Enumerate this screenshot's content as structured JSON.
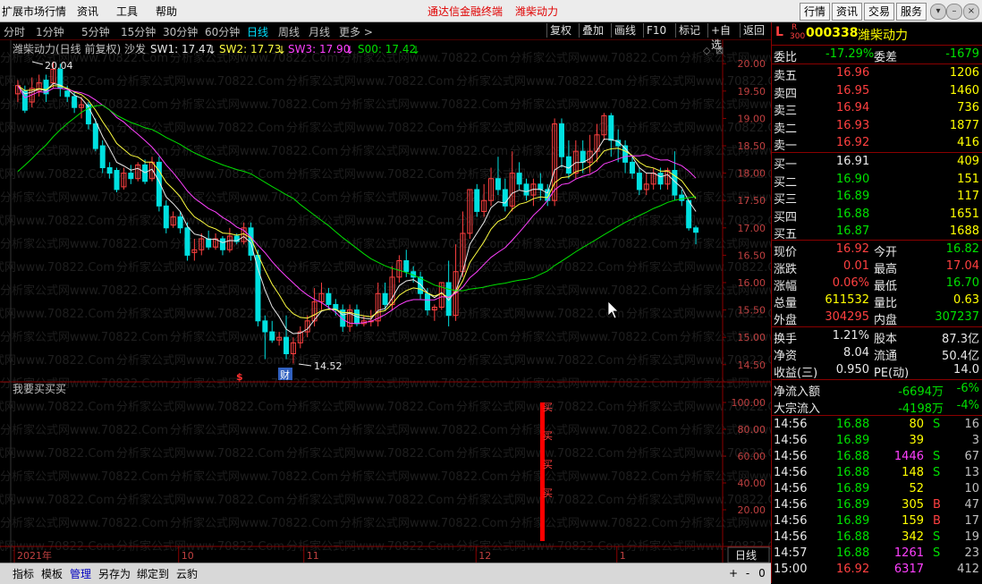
{
  "menubar": {
    "items": [
      "扩展市场行情",
      "资讯",
      "工具",
      "帮助"
    ],
    "center_title": "通达信金融终端",
    "center_stock": "潍柴动力",
    "right_buttons": [
      "行情",
      "资讯",
      "交易",
      "服务"
    ],
    "window_controls": [
      "▾",
      "–",
      "□",
      "×"
    ]
  },
  "periodbar": {
    "periods": [
      "分时",
      "1分钟",
      "5分钟",
      "15分钟",
      "30分钟",
      "60分钟",
      "日线",
      "周线",
      "月线",
      "更多 >"
    ],
    "active": "日线",
    "tools": [
      "复权",
      "叠加",
      "画线",
      "F10",
      "标记",
      "+自选",
      "返回"
    ]
  },
  "main_chart": {
    "title": "潍柴动力(日线 前复权) 沙发",
    "indicators": [
      {
        "label": "SW1: 17.47",
        "arrow": "↓",
        "color": "#e8e8e8"
      },
      {
        "label": "SW2: 17.73",
        "arrow": "↓",
        "color": "#ffff40"
      },
      {
        "label": "SW3: 17.90",
        "arrow": "↓",
        "color": "#ff40ff"
      },
      {
        "label": "S00: 17.42",
        "arrow": "↓",
        "color": "#00e000"
      }
    ],
    "high_label": "20.04",
    "low_label": "14.52",
    "marker_cai": "财",
    "marker_dollar": "$",
    "watermark": "分析家公式网www.70822.Com",
    "y_ticks": [
      "20.00",
      "19.50",
      "19.00",
      "18.50",
      "18.00",
      "17.50",
      "17.00",
      "16.50",
      "16.00",
      "15.50",
      "15.00",
      "14.50"
    ]
  },
  "sub_chart": {
    "title": "我要买买买",
    "y_ticks": [
      "100.00",
      "80.00",
      "60.00",
      "40.00",
      "20.00"
    ],
    "signal_text": "买",
    "signal_value": 100,
    "bar_color": "#ff0000"
  },
  "x_axis": {
    "labels": [
      "2021年",
      "10",
      "11",
      "12",
      "1"
    ],
    "period_label": "日线",
    "zoom_controls": [
      "+",
      "-",
      "0"
    ]
  },
  "bottombar": {
    "tabs": [
      "指标",
      "模板",
      "管理",
      "另存为",
      "绑定到",
      "云豹"
    ],
    "active": "管理"
  },
  "quote": {
    "code": "000338",
    "name": "潍柴动力",
    "prefix_l": "L",
    "prefix_r": "R",
    "prefix_300": "300",
    "weibi_label": "委比",
    "weibi": "-17.29%",
    "weicha_label": "委差",
    "weicha": "-1679",
    "sells": [
      {
        "label": "卖五",
        "price": "16.96",
        "vol": "1206"
      },
      {
        "label": "卖四",
        "price": "16.95",
        "vol": "1460"
      },
      {
        "label": "卖三",
        "price": "16.94",
        "vol": "736"
      },
      {
        "label": "卖二",
        "price": "16.93",
        "vol": "1877"
      },
      {
        "label": "卖一",
        "price": "16.92",
        "vol": "416"
      }
    ],
    "buys": [
      {
        "label": "买一",
        "price": "16.91",
        "vol": "409"
      },
      {
        "label": "买二",
        "price": "16.90",
        "vol": "151"
      },
      {
        "label": "买三",
        "price": "16.89",
        "vol": "117"
      },
      {
        "label": "买四",
        "price": "16.88",
        "vol": "1651"
      },
      {
        "label": "买五",
        "price": "16.87",
        "vol": "1688"
      }
    ],
    "stats": [
      {
        "l1": "现价",
        "v1": "16.92",
        "c1": "red",
        "l2": "今开",
        "v2": "16.82",
        "c2": "green"
      },
      {
        "l1": "涨跌",
        "v1": "0.01",
        "c1": "red",
        "l2": "最高",
        "v2": "17.04",
        "c2": "red"
      },
      {
        "l1": "涨幅",
        "v1": "0.06%",
        "c1": "red",
        "l2": "最低",
        "v2": "16.70",
        "c2": "green"
      },
      {
        "l1": "总量",
        "v1": "611532",
        "c1": "yellow",
        "l2": "量比",
        "v2": "0.63",
        "c2": "yellow"
      },
      {
        "l1": "外盘",
        "v1": "304295",
        "c1": "red",
        "l2": "内盘",
        "v2": "307237",
        "c2": "green"
      }
    ],
    "stats2": [
      {
        "l1": "换手",
        "v1": "1.21%",
        "l2": "股本",
        "v2": "87.3亿"
      },
      {
        "l1": "净资",
        "v1": "8.04",
        "l2": "流通",
        "v2": "50.4亿"
      },
      {
        "l1": "收益(三)",
        "v1": "0.950",
        "l2": "PE(动)",
        "v2": "14.0"
      }
    ],
    "flow": [
      {
        "label": "净流入额",
        "value": "-6694万",
        "pct": "-6%"
      },
      {
        "label": "大宗流入",
        "value": "-4198万",
        "pct": "-4%"
      }
    ],
    "ticks": [
      {
        "time": "14:56",
        "price": "16.88",
        "vol": "80",
        "bs": "S",
        "n": "16",
        "vc": "yellow"
      },
      {
        "time": "14:56",
        "price": "16.89",
        "vol": "39",
        "bs": "",
        "n": "3",
        "vc": "yellow"
      },
      {
        "time": "14:56",
        "price": "16.88",
        "vol": "1446",
        "bs": "S",
        "n": "67",
        "vc": "magenta"
      },
      {
        "time": "14:56",
        "price": "16.88",
        "vol": "148",
        "bs": "S",
        "n": "13",
        "vc": "yellow"
      },
      {
        "time": "14:56",
        "price": "16.89",
        "vol": "52",
        "bs": "",
        "n": "10",
        "vc": "yellow"
      },
      {
        "time": "14:56",
        "price": "16.89",
        "vol": "305",
        "bs": "B",
        "n": "47",
        "vc": "yellow"
      },
      {
        "time": "14:56",
        "price": "16.89",
        "vol": "159",
        "bs": "B",
        "n": "17",
        "vc": "yellow"
      },
      {
        "time": "14:56",
        "price": "16.88",
        "vol": "342",
        "bs": "S",
        "n": "19",
        "vc": "yellow"
      },
      {
        "time": "14:57",
        "price": "16.88",
        "vol": "1261",
        "bs": "S",
        "n": "23",
        "vc": "magenta"
      },
      {
        "time": "15:00",
        "price": "16.92",
        "vol": "6317",
        "bs": "",
        "n": "412",
        "vc": "magenta"
      }
    ]
  },
  "chart_data": {
    "type": "candlestick",
    "ylim": [
      14.3,
      20.2
    ],
    "x_month_labels": [
      "2021年",
      "10",
      "11",
      "12",
      "1"
    ],
    "candles": [
      [
        19.45,
        19.6,
        19.3,
        19.7
      ],
      [
        19.5,
        19.15,
        19.1,
        19.6
      ],
      [
        19.3,
        19.55,
        19.2,
        19.75
      ],
      [
        19.5,
        19.65,
        19.4,
        19.8
      ],
      [
        19.7,
        19.45,
        19.3,
        19.8
      ],
      [
        19.65,
        19.9,
        19.55,
        20.04
      ],
      [
        19.9,
        19.55,
        19.4,
        20.0
      ],
      [
        19.5,
        19.4,
        19.3,
        19.6
      ],
      [
        19.4,
        19.2,
        19.1,
        19.5
      ],
      [
        19.2,
        19.25,
        19.0,
        19.4
      ],
      [
        19.25,
        18.9,
        18.8,
        19.3
      ],
      [
        18.9,
        18.45,
        18.4,
        19.0
      ],
      [
        18.5,
        18.1,
        18.0,
        18.6
      ],
      [
        18.1,
        18.0,
        17.9,
        18.2
      ],
      [
        18.05,
        17.7,
        17.65,
        18.1
      ],
      [
        17.75,
        18.0,
        17.7,
        18.1
      ],
      [
        18.0,
        17.9,
        17.8,
        18.15
      ],
      [
        17.9,
        18.15,
        17.85,
        18.2
      ],
      [
        18.15,
        17.85,
        17.8,
        18.25
      ],
      [
        17.9,
        18.2,
        17.85,
        18.3
      ],
      [
        18.2,
        17.4,
        17.3,
        18.3
      ],
      [
        17.4,
        17.0,
        16.9,
        17.5
      ],
      [
        17.05,
        17.2,
        17.0,
        17.3
      ],
      [
        17.2,
        17.0,
        16.9,
        17.3
      ],
      [
        17.0,
        16.5,
        16.4,
        17.1
      ],
      [
        16.55,
        16.6,
        16.4,
        16.8
      ],
      [
        16.6,
        16.8,
        16.5,
        16.9
      ],
      [
        16.8,
        16.65,
        16.6,
        16.95
      ],
      [
        16.65,
        16.8,
        16.6,
        16.9
      ],
      [
        16.8,
        16.6,
        16.5,
        16.85
      ],
      [
        16.6,
        16.85,
        16.55,
        17.0
      ],
      [
        16.85,
        16.75,
        16.7,
        16.9
      ],
      [
        16.75,
        17.0,
        16.7,
        17.1
      ],
      [
        17.0,
        16.5,
        16.4,
        17.1
      ],
      [
        16.5,
        15.3,
        15.2,
        16.6
      ],
      [
        15.3,
        15.1,
        14.6,
        15.4
      ],
      [
        15.1,
        14.95,
        14.9,
        15.3
      ],
      [
        14.95,
        15.0,
        14.85,
        15.1
      ],
      [
        15.0,
        14.7,
        14.6,
        15.4
      ],
      [
        14.7,
        14.9,
        14.52,
        15.0
      ],
      [
        14.9,
        15.1,
        14.8,
        15.2
      ],
      [
        15.1,
        15.3,
        15.0,
        15.4
      ],
      [
        15.3,
        15.65,
        15.2,
        15.9
      ],
      [
        15.65,
        15.8,
        15.5,
        16.0
      ],
      [
        15.8,
        15.6,
        15.5,
        15.9
      ],
      [
        15.6,
        15.5,
        15.4,
        15.7
      ],
      [
        15.5,
        15.2,
        15.1,
        15.6
      ],
      [
        15.2,
        15.5,
        15.1,
        15.6
      ],
      [
        15.5,
        15.25,
        15.2,
        15.6
      ],
      [
        15.25,
        15.3,
        15.2,
        15.4
      ],
      [
        15.3,
        15.3,
        15.2,
        15.5
      ],
      [
        15.3,
        15.8,
        15.2,
        16.0
      ],
      [
        15.8,
        15.6,
        15.5,
        16.0
      ],
      [
        15.6,
        16.1,
        15.5,
        16.3
      ],
      [
        16.1,
        16.4,
        16.0,
        16.5
      ],
      [
        16.4,
        16.2,
        16.1,
        16.6
      ],
      [
        16.2,
        16.1,
        16.0,
        16.3
      ],
      [
        16.1,
        15.8,
        15.7,
        16.2
      ],
      [
        15.8,
        15.5,
        15.4,
        15.9
      ],
      [
        15.5,
        15.55,
        15.3,
        15.6
      ],
      [
        15.55,
        16.0,
        15.5,
        16.0
      ],
      [
        16.0,
        15.4,
        15.2,
        16.4
      ],
      [
        15.4,
        16.2,
        15.3,
        16.7
      ],
      [
        16.2,
        16.9,
        16.1,
        17.3
      ],
      [
        16.9,
        17.7,
        16.8,
        17.7
      ],
      [
        17.7,
        17.3,
        17.2,
        17.8
      ],
      [
        17.3,
        17.5,
        17.2,
        17.8
      ],
      [
        17.5,
        17.9,
        17.4,
        18.1
      ],
      [
        17.9,
        17.7,
        17.6,
        18.3
      ],
      [
        17.7,
        17.4,
        17.3,
        17.9
      ],
      [
        17.4,
        18.0,
        17.3,
        18.4
      ],
      [
        18.0,
        17.8,
        17.7,
        18.2
      ],
      [
        17.8,
        17.6,
        17.5,
        17.9
      ],
      [
        17.6,
        17.8,
        17.4,
        17.9
      ],
      [
        17.8,
        17.7,
        17.5,
        18.0
      ],
      [
        17.7,
        17.5,
        17.4,
        17.8
      ],
      [
        17.5,
        18.9,
        17.4,
        19.0
      ],
      [
        18.9,
        18.3,
        18.1,
        19.0
      ],
      [
        18.3,
        18.0,
        17.9,
        18.6
      ],
      [
        18.0,
        18.4,
        17.9,
        18.6
      ],
      [
        18.4,
        18.2,
        18.0,
        18.6
      ],
      [
        18.2,
        18.4,
        18.0,
        18.7
      ],
      [
        18.4,
        18.7,
        18.2,
        18.9
      ],
      [
        18.7,
        19.05,
        18.6,
        19.1
      ],
      [
        19.05,
        18.6,
        18.3,
        19.1
      ],
      [
        18.6,
        18.5,
        18.2,
        18.8
      ],
      [
        18.5,
        18.2,
        18.0,
        18.6
      ],
      [
        18.2,
        18.0,
        17.9,
        18.3
      ],
      [
        18.0,
        17.7,
        17.6,
        18.1
      ],
      [
        17.7,
        17.8,
        17.6,
        18.0
      ],
      [
        17.8,
        18.0,
        17.7,
        18.1
      ],
      [
        18.0,
        17.8,
        17.7,
        18.1
      ],
      [
        17.8,
        18.05,
        17.7,
        18.1
      ],
      [
        18.05,
        17.6,
        17.5,
        18.4
      ],
      [
        17.6,
        17.5,
        17.4,
        17.7
      ],
      [
        17.5,
        17.0,
        16.95,
        17.5
      ],
      [
        17.0,
        16.92,
        16.7,
        17.04
      ]
    ]
  }
}
